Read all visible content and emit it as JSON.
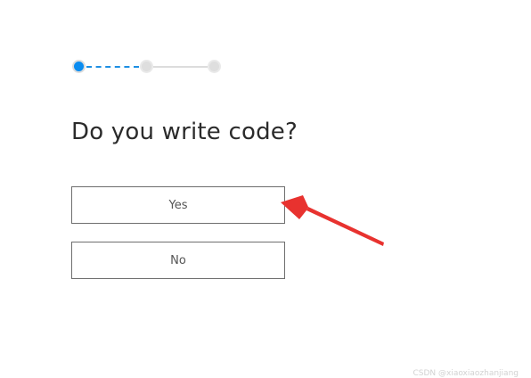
{
  "stepper": {
    "steps": [
      {
        "state": "active"
      },
      {
        "state": "inactive"
      },
      {
        "state": "inactive"
      }
    ],
    "colors": {
      "active": "#0a8cf0",
      "inactive": "#dedede"
    }
  },
  "question": {
    "text": "Do you write code?"
  },
  "answers": {
    "yes_label": "Yes",
    "no_label": "No"
  },
  "annotation": {
    "arrow_color": "#e8322f",
    "icon": "arrow-pointer-icon"
  },
  "watermark": {
    "text": "CSDN @xiaoxiaozhanjiang"
  }
}
